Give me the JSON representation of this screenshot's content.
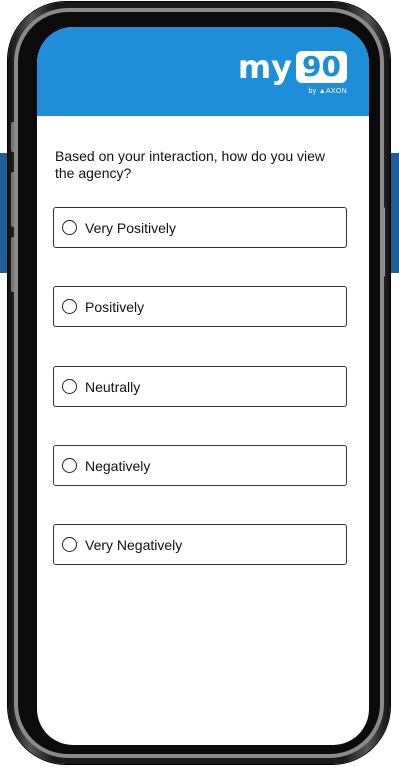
{
  "header": {
    "logo_text": "my",
    "logo_number": "90",
    "logo_byline": "by ▲AXON",
    "background_color": "#1d8ed7"
  },
  "survey": {
    "question": "Based on your interaction, how do you view the agency?",
    "options": [
      {
        "label": "Very Positively",
        "selected": false
      },
      {
        "label": "Positively",
        "selected": false
      },
      {
        "label": "Neutrally",
        "selected": false
      },
      {
        "label": "Negatively",
        "selected": false
      },
      {
        "label": "Very Negatively",
        "selected": false
      }
    ]
  },
  "colors": {
    "background_band": "#1f5f97",
    "phone_frame": "#1a1a1a"
  }
}
